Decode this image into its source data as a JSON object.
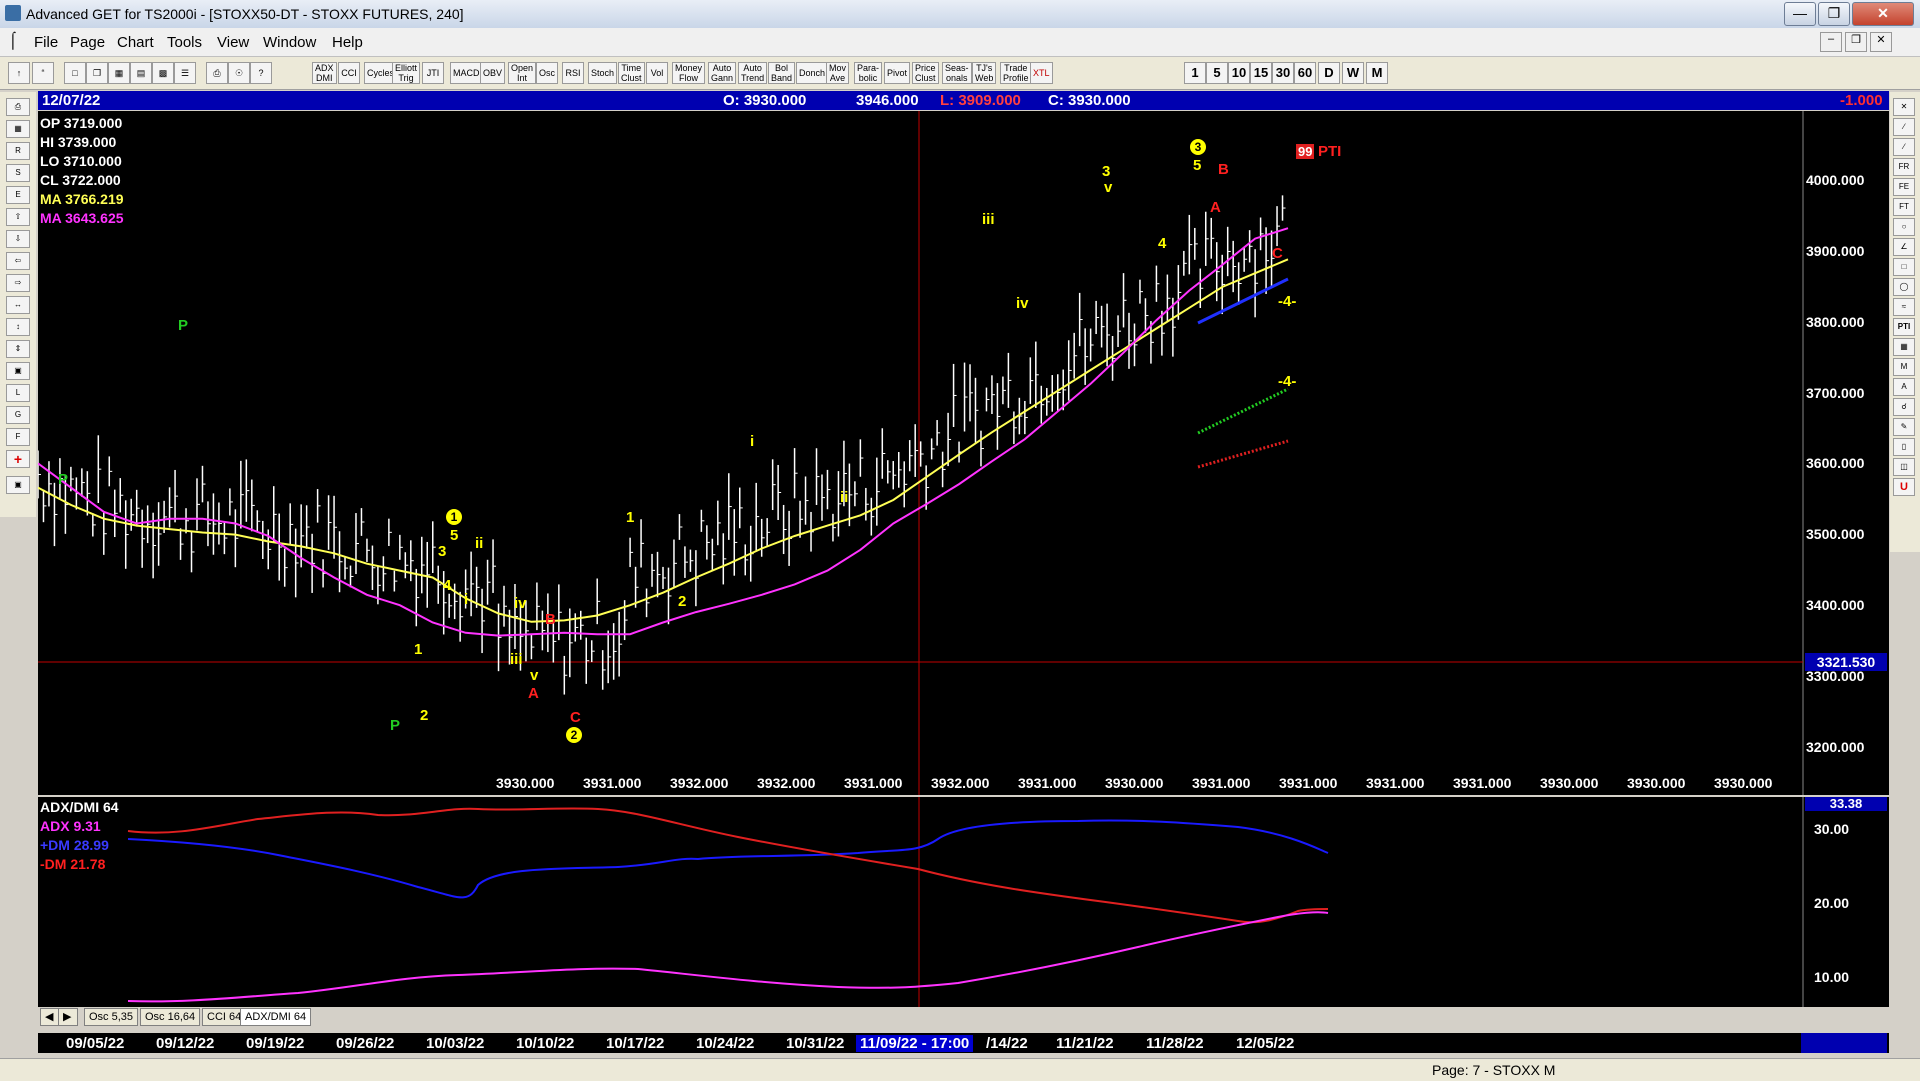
{
  "window": {
    "title": "Advanced GET for TS2000i - [STOXX50-DT - STOXX FUTURES, 240]"
  },
  "menu": {
    "items": [
      "File",
      "Page",
      "Chart",
      "Tools",
      "View",
      "Window",
      "Help"
    ]
  },
  "toolbar": {
    "studies": [
      "ADX DMI",
      "CCI",
      "Cycles",
      "Elliott Trig",
      "JTI",
      "MACD",
      "OBV",
      "Open Int",
      "Osc",
      "RSI",
      "Stoch",
      "Time Clust",
      "Vol",
      "Money Flow",
      "Auto Gann",
      "Auto Trend",
      "Bol Band",
      "Donch",
      "Mov Ave",
      "Para-bolic",
      "Pivot",
      "Price Clust",
      "Seas-onals",
      "TJ's Web",
      "Trade Profile",
      "XTL"
    ],
    "intervals": [
      "1",
      "5",
      "10",
      "15",
      "30",
      "60",
      "D",
      "W",
      "M"
    ]
  },
  "header": {
    "date": "12/07/22",
    "open": "O: 3930.000",
    "high": "3946.000",
    "low": "L: 3909.000",
    "close": "C: 3930.000",
    "change": "-1.000"
  },
  "ohlc_box": {
    "op": "OP  3719.000",
    "hi": "HI   3739.000",
    "lo": "LO   3710.000",
    "cl": "CL   3722.000",
    "ma1": "MA  3766.219",
    "ma2": "MA  3643.625"
  },
  "price_axis": {
    "ticks": [
      "4000.000",
      "3900.000",
      "3800.000",
      "3700.000",
      "3600.000",
      "3500.000",
      "3400.000",
      "3300.000",
      "3200.000"
    ],
    "cursor_value": "3321.530"
  },
  "bottom_values": [
    "3930.000",
    "3931.000",
    "3932.000",
    "3932.000",
    "3931.000",
    "3932.000",
    "3931.000",
    "3930.000",
    "3931.000",
    "3931.000",
    "3931.000",
    "3931.000",
    "3930.000",
    "3930.000",
    "3930.000"
  ],
  "pti": {
    "value": "99",
    "label": "PTI"
  },
  "wave_labels": {
    "p": "P",
    "one": "1",
    "two": "2",
    "three": "3",
    "four": "4",
    "five": "5",
    "i": "i",
    "ii": "ii",
    "iii": "iii",
    "iv": "iv",
    "v": "v",
    "a": "A",
    "b": "B",
    "c": "C",
    "proj": "-4-",
    "circ1": "1",
    "circ2": "2",
    "circ3": "3"
  },
  "osc_panel": {
    "title": "ADX/DMI 64",
    "adx": "ADX 9.31",
    "plus_dm": "+DM 28.99",
    "minus_dm": "-DM  21.78",
    "axis": [
      "30.00",
      "20.00",
      "10.00"
    ],
    "cursor_value": "33.38"
  },
  "tabs": [
    "Osc 5,35",
    "Osc 16,64",
    "CCI 64",
    "ADX/DMI 64"
  ],
  "dates": {
    "labels": [
      "09/05/22",
      "09/12/22",
      "09/19/22",
      "09/26/22",
      "10/03/22",
      "10/10/22",
      "10/17/22",
      "10/24/22",
      "10/31/22",
      "11/09/22 - 17:00",
      "/14/22",
      "11/21/22",
      "11/28/22",
      "12/05/22"
    ]
  },
  "status": {
    "page": "Page: 7 - STOXX M"
  },
  "colors": {
    "ma_fast": "#ffff55",
    "ma_slow": "#ff33ff",
    "plus_dm": "#1a1aff",
    "minus_dm": "#ff2020",
    "adx": "#ff33ff",
    "wave_yellow": "#ffff00",
    "wave_red": "#ff2020",
    "wave_green": "#22cc22"
  },
  "chart_data": {
    "type": "line",
    "series": [
      {
        "name": "MA  3766.219",
        "values": [
          3580,
          3555,
          3535,
          3525,
          3520,
          3515,
          3512,
          3502,
          3495,
          3485,
          3470,
          3460,
          3450,
          3420,
          3398,
          3386,
          3388,
          3395,
          3410,
          3428,
          3450,
          3470,
          3492,
          3510,
          3525,
          3540,
          3562,
          3595,
          3628,
          3660,
          3690,
          3720,
          3750,
          3780,
          3810,
          3840,
          3870,
          3890,
          3910
        ]
      },
      {
        "name": "MA  3643.625",
        "values": [
          3615,
          3580,
          3545,
          3528,
          3535,
          3535,
          3528,
          3510,
          3478,
          3450,
          3425,
          3410,
          3385,
          3370,
          3366,
          3368,
          3370,
          3368,
          3368,
          3385,
          3400,
          3412,
          3425,
          3440,
          3460,
          3490,
          3528,
          3556,
          3585,
          3618,
          3650,
          3690,
          3730,
          3775,
          3822,
          3865,
          3902,
          3940,
          3955
        ]
      }
    ],
    "ylim": [
      3150,
      4110
    ]
  }
}
